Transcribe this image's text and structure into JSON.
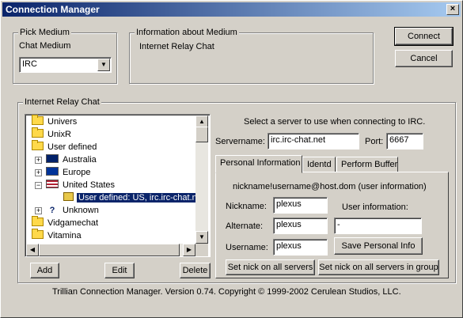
{
  "window": {
    "title": "Connection Manager",
    "close_glyph": "×"
  },
  "pick_medium": {
    "legend": "Pick Medium",
    "label": "Chat Medium",
    "selected": "IRC"
  },
  "info": {
    "legend": "Information about Medium",
    "text": "Internet Relay Chat"
  },
  "buttons": {
    "connect": "Connect",
    "cancel": "Cancel",
    "add": "Add",
    "edit": "Edit",
    "delete": "Delete"
  },
  "irc": {
    "legend": "Internet Relay Chat",
    "tree": {
      "univers": "Univers",
      "unixr": "UnixR",
      "user_defined": "User defined",
      "australia": "Australia",
      "europe": "Europe",
      "united_states": "United States",
      "server": "User defined: US, irc.irc-chat.net",
      "unknown": "Unknown",
      "vidgamechat": "Vidgamechat",
      "vitamina": "Vitamina",
      "unknown_glyph": "?"
    },
    "select_prompt": "Select a server to use when connecting to IRC.",
    "servername_label": "Servername:",
    "servername_value": "irc.irc-chat.net",
    "port_label": "Port:",
    "port_value": "6667"
  },
  "tabs": [
    "Personal Information",
    "Identd",
    "Perform Buffer"
  ],
  "personal": {
    "format_hint": "nickname!username@host.dom  (user information)",
    "nickname_label": "Nickname:",
    "nickname_value": "plexus",
    "alternate_label": "Alternate:",
    "alternate_value": "plexus",
    "username_label": "Username:",
    "username_value": "plexus",
    "userinfo_label": "User information:",
    "userinfo_value": "-",
    "save_button": "Save Personal Info",
    "set_nick_all": "Set nick on all servers",
    "set_nick_group": "Set nick on all servers in group"
  },
  "footer": "Trillian Connection Manager.  Version 0.74.  Copyright © 1999-2002 Cerulean Studios, LLC.",
  "colors": {
    "titlebar_start": "#0a246a",
    "titlebar_end": "#a6caf0",
    "selection": "#0a246a",
    "face": "#d4d0c8"
  }
}
